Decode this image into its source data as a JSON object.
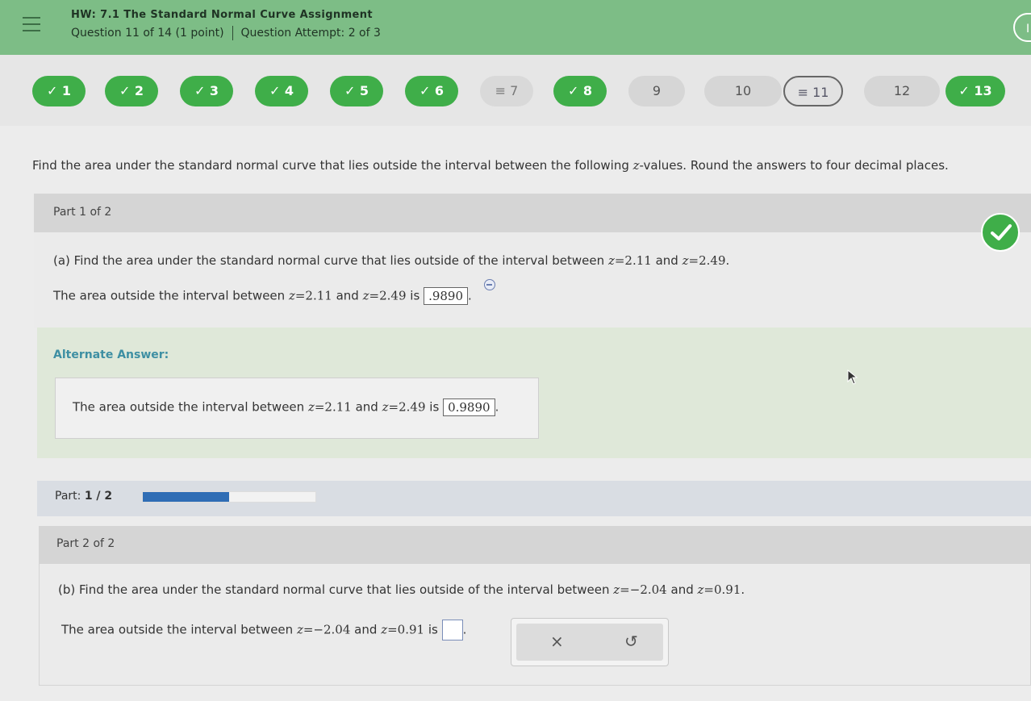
{
  "header": {
    "title": "HW: 7.1 The Standard Normal Curve Assignment",
    "question_info": "Question 11 of 14 (1 point)",
    "attempt_info": "Question Attempt: 2 of 3",
    "right_button_label": "I"
  },
  "question_nav": [
    {
      "label": "1",
      "status": "correct"
    },
    {
      "label": "2",
      "status": "correct"
    },
    {
      "label": "3",
      "status": "correct"
    },
    {
      "label": "4",
      "status": "correct"
    },
    {
      "label": "5",
      "status": "correct"
    },
    {
      "label": "6",
      "status": "correct"
    },
    {
      "label": "7",
      "status": "partial"
    },
    {
      "label": "8",
      "status": "correct"
    },
    {
      "label": "9",
      "status": "unanswered"
    },
    {
      "label": "10",
      "status": "unanswered"
    },
    {
      "label": "11",
      "status": "current-partial"
    },
    {
      "label": "12",
      "status": "unanswered"
    },
    {
      "label": "13",
      "status": "correct"
    }
  ],
  "instructions": {
    "pre": "Find the area under the standard normal curve that lies outside the interval between the following ",
    "var": "z",
    "post": "-values. Round the answers to four decimal places."
  },
  "part1": {
    "header": "Part 1 of 2",
    "question": {
      "prefix": "(a) Find the area under the standard normal curve that lies outside of the interval between",
      "z1": "2.11",
      "z2": "2.49"
    },
    "answer_line": {
      "prefix": "The area outside the interval between",
      "z1": "2.11",
      "z2": "2.49",
      "is": "is",
      "value": ".9890"
    },
    "alternate": {
      "label": "Alternate Answer:",
      "prefix": "The area outside the interval between",
      "z1": "2.11",
      "z2": "2.49",
      "is": "is",
      "value": "0.9890"
    }
  },
  "progress": {
    "label": "Part:",
    "value": "1 / 2",
    "fraction": 0.5
  },
  "part2": {
    "header": "Part 2 of 2",
    "question": {
      "prefix": "(b) Find the area under the standard normal curve that lies outside of the interval between",
      "z1": "−2.04",
      "z2": "0.91"
    },
    "answer_line": {
      "prefix": "The area outside the interval between",
      "z1": "−2.04",
      "z2": "0.91",
      "is": "is"
    },
    "tools": {
      "clear": "×",
      "undo": "↺"
    }
  },
  "common": {
    "z": "z",
    "eq": "=",
    "and": "and",
    "period": "."
  },
  "colors": {
    "header_bg": "#7dbd86",
    "correct_green": "#3fae49",
    "progress_blue": "#2f6db5",
    "alternate_label": "#3e8fa3"
  }
}
